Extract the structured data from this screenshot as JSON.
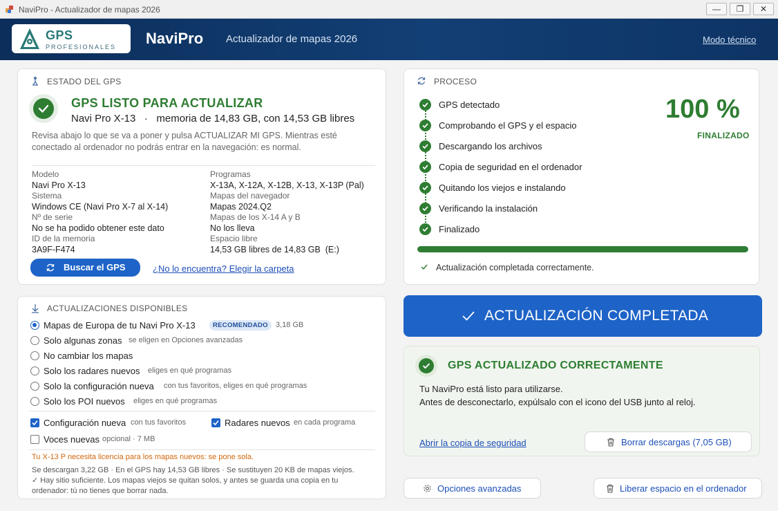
{
  "window": {
    "title": "NaviPro - Actualizador de mapas 2026",
    "min_glyph": "—",
    "max_glyph": "❐",
    "close_glyph": "✕"
  },
  "header": {
    "logo_main": "GPS",
    "logo_sub": "PROFESIONALES",
    "app_name": "NaviPro",
    "subtitle": "Actualizador de mapas 2026",
    "tech_mode": "Modo técnico"
  },
  "estado": {
    "section_title": "ESTADO DEL GPS",
    "status_title": "GPS LISTO PARA ACTUALIZAR",
    "device_line": "Navi Pro X-13   ·   memoria de 14,83 GB, con 14,53 GB libres",
    "description": "Revisa abajo lo que se va a poner y pulsa ACTUALIZAR MI GPS. Mientras esté conectado al ordenador no podrás entrar en la navegación: es normal.",
    "info_left": [
      {
        "label": "Modelo",
        "value": "Navi Pro X-13"
      },
      {
        "label": "Sistema",
        "value": "Windows CE (Navi Pro X-7 al X-14)"
      },
      {
        "label": "Nº de serie",
        "value": "No se ha podido obtener este dato"
      },
      {
        "label": "ID de la memoria",
        "value": "3A9F-F474"
      }
    ],
    "info_right": [
      {
        "label": "Programas",
        "value": "X-13A, X-12A, X-12B, X-13, X-13P (Pal)"
      },
      {
        "label": "Mapas del navegador",
        "value": "Mapas 2024.Q2"
      },
      {
        "label": "Mapas de los X-14 A y B",
        "value": "No los lleva"
      },
      {
        "label": "Espacio libre",
        "value": "14,53 GB libres de 14,83 GB  (E:)"
      }
    ],
    "search_button": "Buscar el GPS",
    "choose_folder_link": "¿No lo encuentra? Elegir la carpeta"
  },
  "updates": {
    "section_title": "ACTUALIZACIONES DISPONIBLES",
    "options": [
      {
        "label": "Mapas de Europa de tu Navi Pro X-13",
        "badge": "RECOMENDADO",
        "hint": "3,18 GB",
        "selected": true
      },
      {
        "label": "Solo algunas zonas",
        "hint": "se eligen en Opciones avanzadas",
        "selected": false
      },
      {
        "label": "No cambiar los mapas",
        "hint": "",
        "selected": false
      },
      {
        "label": "Solo los radares nuevos",
        "hint": "eliges en qué programas",
        "selected": false
      },
      {
        "label": "Solo la configuración nueva",
        "hint": "con tus favoritos, eliges en qué programas",
        "selected": false
      },
      {
        "label": "Solo los POI nuevos",
        "hint": "eliges en qué programas",
        "selected": false
      }
    ],
    "checks": [
      {
        "label": "Configuración nueva",
        "hint": "con tus favoritos",
        "checked": true
      },
      {
        "label": "Radares nuevos",
        "hint": "en cada programa",
        "checked": true
      },
      {
        "label": "Voces nuevas",
        "hint": "opcional · 7 MB",
        "checked": false
      }
    ],
    "warning": "Tu X-13 P necesita licencia para los mapas nuevos: se pone sola.",
    "note_line1": "Se descargan 3,22 GB · En el GPS hay 14,53 GB libres · Se sustituyen 20 KB de mapas viejos.",
    "note_line2": "✓ Hay sitio suficiente. Los mapas viejos se quitan solos, y antes se guarda una copia en tu",
    "note_line3": "ordenador: tú no tienes que borrar nada."
  },
  "proceso": {
    "section_title": "PROCESO",
    "steps": [
      "GPS detectado",
      "Comprobando el GPS y el espacio",
      "Descargando los archivos",
      "Copia de seguridad en el ordenador",
      "Quitando los viejos e instalando",
      "Verificando la instalación",
      "Finalizado"
    ],
    "percent": "100 %",
    "percent_value": 100,
    "percent_label": "FINALIZADO",
    "done_message": "Actualización completada correctamente."
  },
  "action": {
    "label": "ACTUALIZACIÓN COMPLETADA"
  },
  "success": {
    "title": "GPS ACTUALIZADO CORRECTAMENTE",
    "line1": "Tu NaviPro está listo para utilizarse.",
    "line2": "Antes de desconectarlo, expúlsalo con el icono del USB junto al reloj.",
    "backup_link": "Abrir la copia de seguridad",
    "delete_downloads": "Borrar descargas (7,05 GB)"
  },
  "footer": {
    "advanced": "Opciones avanzadas",
    "free_space": "Liberar espacio en el ordenador"
  },
  "colors": {
    "primary": "#1e63c7",
    "success": "#2e7d32",
    "header": "#0c2e5a",
    "warning": "#d0670c"
  },
  "icons": [
    "app-icon",
    "logo-pin-icon",
    "gps-antenna-icon",
    "check-icon",
    "refresh-icon",
    "download-arrow-icon",
    "gear-icon",
    "trash-icon"
  ]
}
